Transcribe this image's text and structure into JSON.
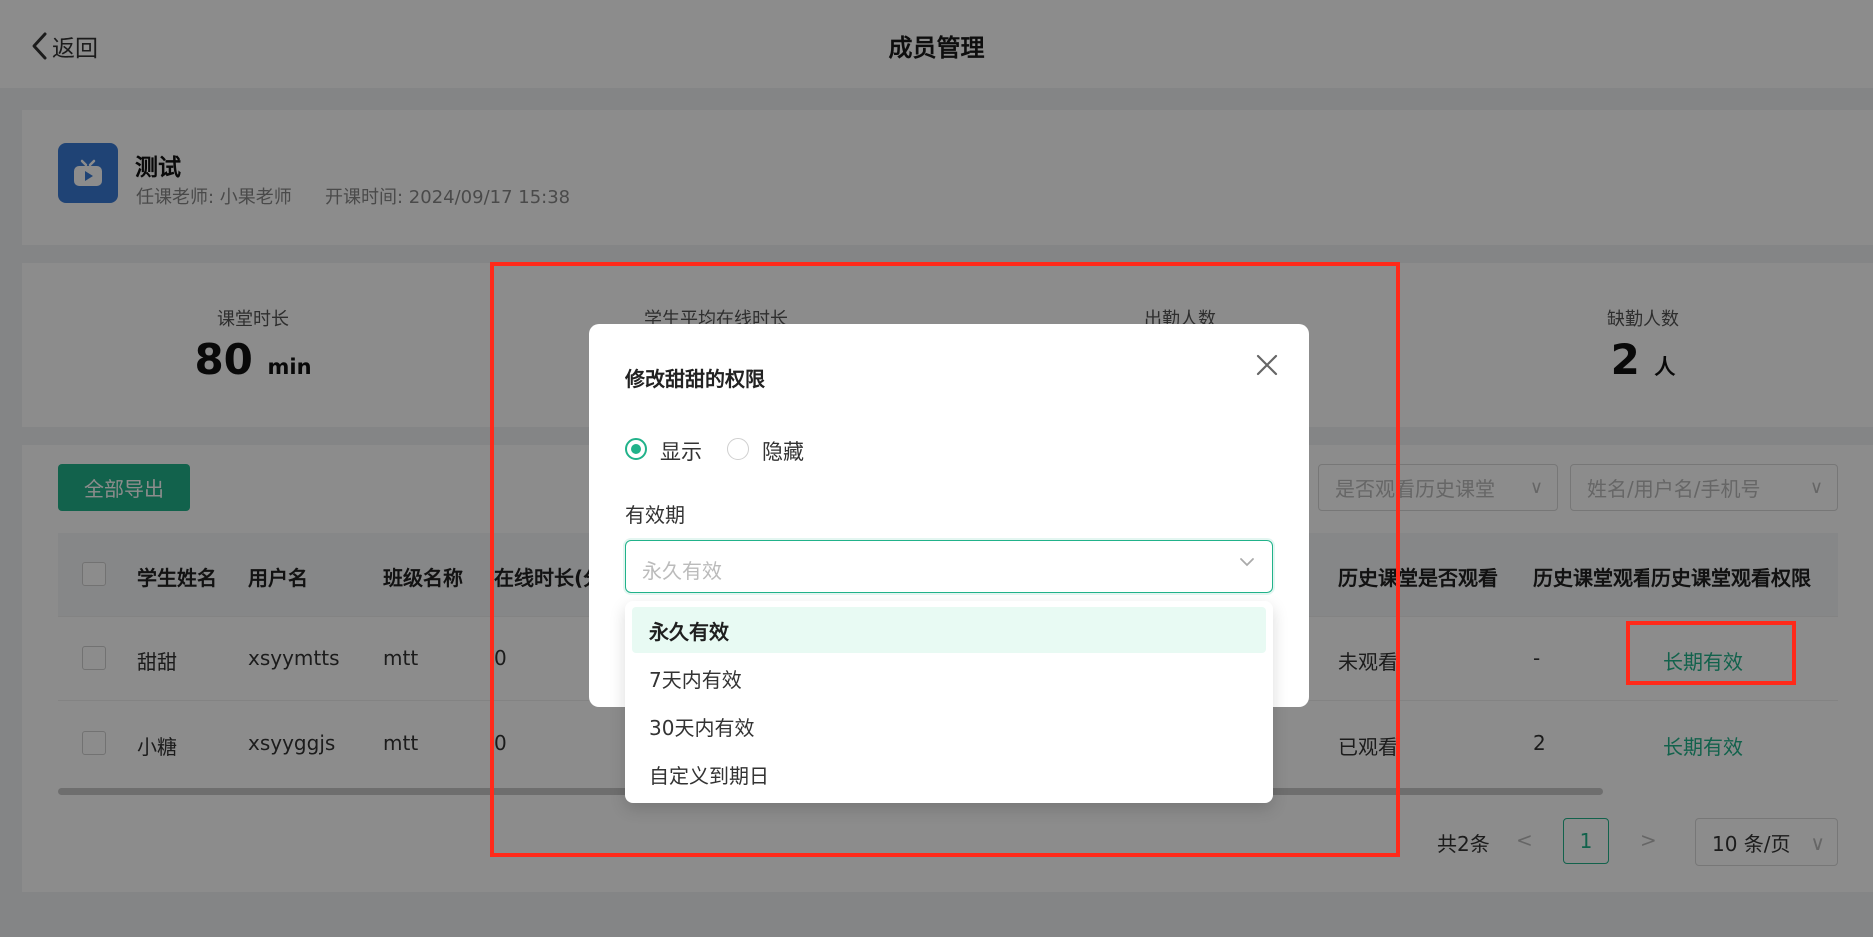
{
  "header": {
    "back_label": "返回",
    "title": "成员管理"
  },
  "course": {
    "name": "测试",
    "teacher": "任课老师: 小果老师",
    "start_time": "开课时间: 2024/09/17 15:38"
  },
  "stats": [
    {
      "label": "课堂时长",
      "value": "80",
      "unit": "min"
    },
    {
      "label": "学生平均在线时长",
      "value": "",
      "unit": ""
    },
    {
      "label": "出勤人数",
      "value": "",
      "unit": ""
    },
    {
      "label": "缺勤人数",
      "value": "2",
      "unit": "人"
    }
  ],
  "toolbar": {
    "export_label": "全部导出",
    "filter_history_placeholder": "是否观看历史课堂",
    "search_placeholder": "姓名/用户名/手机号"
  },
  "table": {
    "headers": [
      "学生姓名",
      "用户名",
      "班级名称",
      "在线时长(分",
      "历史课堂是否观看",
      "历史课堂观看",
      "历史课堂观看权限"
    ],
    "rows": [
      {
        "name": "甜甜",
        "username": "xsyymtts",
        "class": "mtt",
        "online": "0",
        "watched": "未观看",
        "watch_count": "-",
        "permission": "长期有效"
      },
      {
        "name": "小糖",
        "username": "xsyyggjs",
        "class": "mtt",
        "online": "0",
        "watched": "已观看",
        "watch_count": "2",
        "permission": "长期有效"
      }
    ]
  },
  "pagination": {
    "total": "共2条",
    "prev": "<",
    "page": "1",
    "next": ">",
    "page_size": "10 条/页"
  },
  "modal": {
    "title": "修改甜甜的权限",
    "radio_show": "显示",
    "radio_hide": "隐藏",
    "validity_label": "有效期",
    "select_placeholder": "永久有效",
    "options": [
      "永久有效",
      "7天内有效",
      "30天内有效",
      "自定义到期日"
    ],
    "selected_option": "永久有效"
  },
  "colors": {
    "accent": "#21b28a",
    "highlight_box": "#ff2a1a",
    "logo": "#3a7bd5"
  }
}
